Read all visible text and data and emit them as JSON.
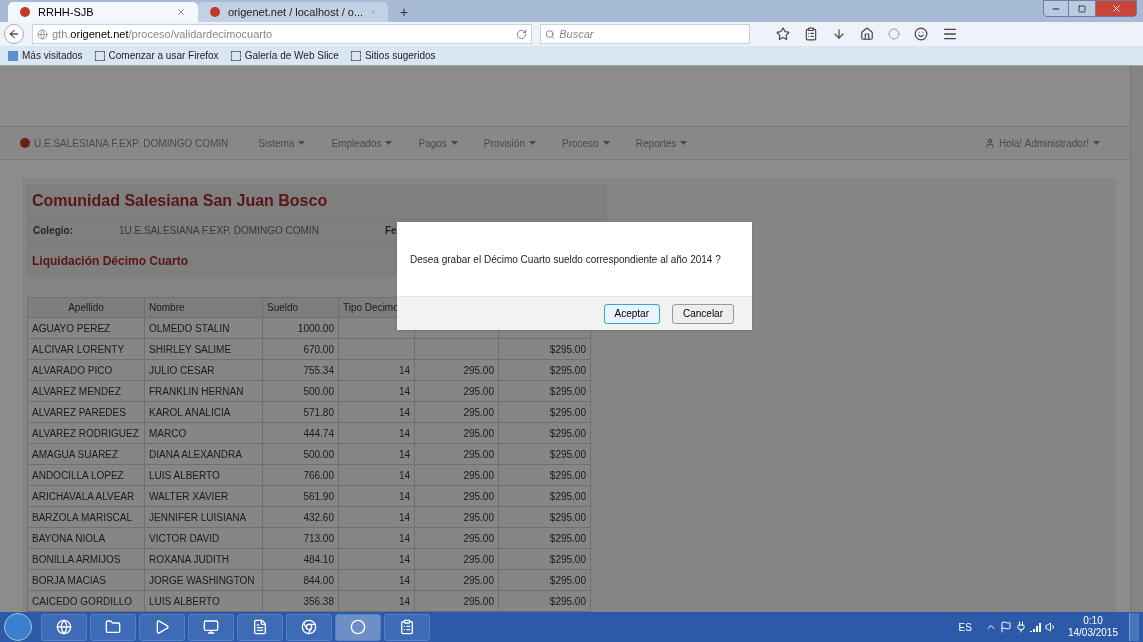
{
  "browser": {
    "tabs": [
      {
        "title": "RRHH-SJB",
        "selected": true
      },
      {
        "title": "origenet.net / localhost / o...",
        "selected": false
      }
    ],
    "new_tab": "+",
    "url": {
      "prefix": "gth.",
      "domain": "origenet.net",
      "path": "/proceso/validardecimocuarto"
    },
    "search": {
      "placeholder": "Buscar"
    },
    "bookmarks": [
      "Más visitados",
      "Comenzar a usar Firefox",
      "Galería de Web Slice",
      "Sitios sugeridos"
    ]
  },
  "page": {
    "brand": "U.E.SALESIANA F.EXP. DOMINGO COMIN",
    "nav": [
      {
        "label": "Sistema"
      },
      {
        "label": "Empleados"
      },
      {
        "label": "Pagos"
      },
      {
        "label": "Provisión"
      },
      {
        "label": "Proceso"
      },
      {
        "label": "Reportes"
      }
    ],
    "user": "Hola! Administrador!",
    "title": "Comunidad Salesiana San Juan Bosco",
    "colegio": {
      "label": "Colegio:",
      "value": "1U.E.SALESIANA F.EXP. DOMINGO COMIN"
    },
    "fecha_label": "Fe",
    "subtitle": "Liquidación Décimo Cuarto",
    "table": {
      "columns": [
        "Apellido",
        "Nombre",
        "Sueldo",
        "Tipo Decimo"
      ],
      "rows": [
        {
          "apellido": "AGUAYO PEREZ",
          "nombre": "OLMEDO STALIN",
          "sueldo": "1000.00"
        },
        {
          "apellido": "ALCIVAR LORENTY",
          "nombre": "SHIRLEY SALIME",
          "sueldo": "670.00",
          "column_6": "$295.00"
        },
        {
          "apellido": "ALVARADO PICO",
          "nombre": "JULIO CESAR",
          "sueldo": "755.34",
          "tipo_decimo": "14",
          "column_5": "295.00",
          "column_6": "$295.00"
        },
        {
          "apellido": "ALVAREZ MENDEZ",
          "nombre": "FRANKLIN HERNAN",
          "sueldo": "500.00",
          "tipo_decimo": "14",
          "column_5": "295.00",
          "column_6": "$295.00"
        },
        {
          "apellido": "ALVAREZ PAREDES",
          "nombre": "KAROL ANALICIA",
          "sueldo": "571.80",
          "tipo_decimo": "14",
          "column_5": "295.00",
          "column_6": "$295.00"
        },
        {
          "apellido": "ALVAREZ RODRIGUEZ",
          "nombre": "MARCO",
          "sueldo": "444.74",
          "tipo_decimo": "14",
          "column_5": "295.00",
          "column_6": "$295.00"
        },
        {
          "apellido": "AMAGUA SUAREZ",
          "nombre": "DIANA ALEXANDRA",
          "sueldo": "500.00",
          "tipo_decimo": "14",
          "column_5": "295.00",
          "column_6": "$295.00"
        },
        {
          "apellido": "ANDOCILLA LOPEZ",
          "nombre": "LUIS ALBERTO",
          "sueldo": "766.00",
          "tipo_decimo": "14",
          "column_5": "295.00",
          "column_6": "$295.00"
        },
        {
          "apellido": "ARICHAVALA ALVEAR",
          "nombre": "WALTER XAVIER",
          "sueldo": "561.90",
          "tipo_decimo": "14",
          "column_5": "295.00",
          "column_6": "$295.00"
        },
        {
          "apellido": "BARZOLA MARISCAL",
          "nombre": "JENNIFER LUISIANA",
          "sueldo": "432.60",
          "tipo_decimo": "14",
          "column_5": "295.00",
          "column_6": "$295.00"
        },
        {
          "apellido": "BAYONA NIOLA",
          "nombre": "VICTOR DAVID",
          "sueldo": "713.00",
          "tipo_decimo": "14",
          "column_5": "295.00",
          "column_6": "$295.00"
        },
        {
          "apellido": "BONILLA ARMIJOS",
          "nombre": "ROXANA JUDITH",
          "sueldo": "484.10",
          "tipo_decimo": "14",
          "column_5": "295.00",
          "column_6": "$295.00"
        },
        {
          "apellido": "BORJA MACIAS",
          "nombre": "JORGE WASHINGTON",
          "sueldo": "844.00",
          "tipo_decimo": "14",
          "column_5": "295.00",
          "column_6": "$295.00"
        },
        {
          "apellido": "CAICEDO GORDILLO",
          "nombre": "LUIS ALBERTO",
          "sueldo": "356.38",
          "tipo_decimo": "14",
          "column_5": "295.00",
          "column_6": "$295.00"
        }
      ]
    }
  },
  "dialog": {
    "message": "Desea grabar el Décimo Cuarto sueldo correspondiente al año 2014  ?",
    "buttons": [
      {
        "label": "Aceptar",
        "primary": true
      },
      {
        "label": "Cancelar",
        "primary": false
      }
    ]
  },
  "taskbar": {
    "language": "ES",
    "time": "0:10",
    "date": "14/03/2015"
  }
}
